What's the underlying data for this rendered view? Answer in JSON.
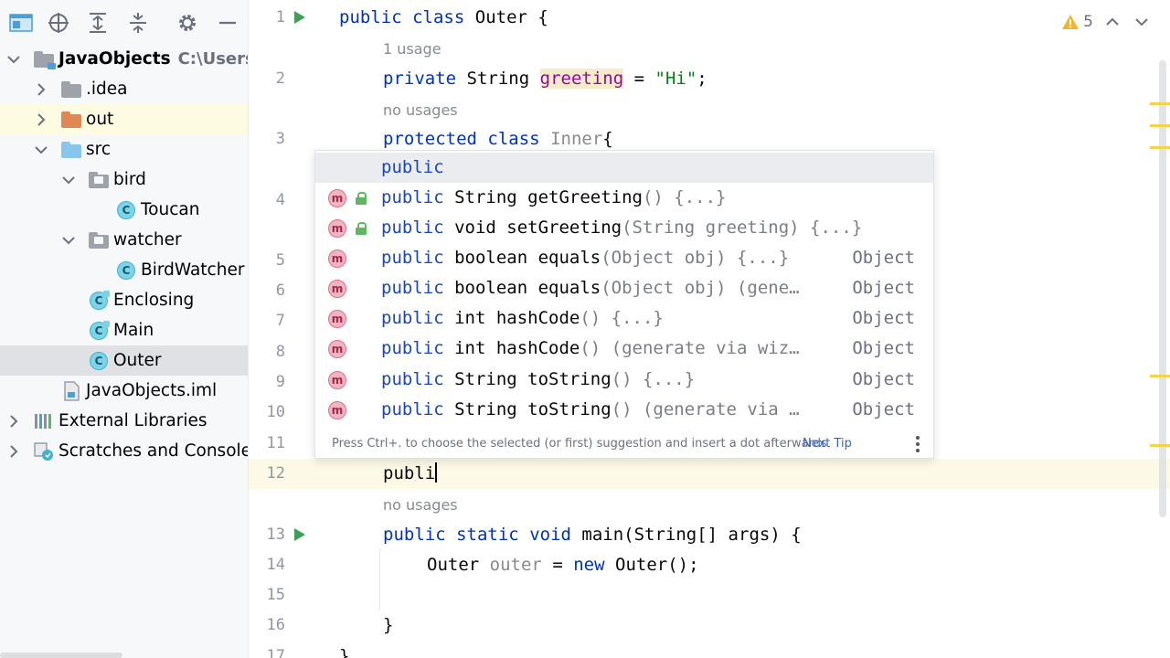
{
  "project_tree": [
    {
      "label": "JavaObjects",
      "path": "C:\\Users\\r",
      "icon": "module-folder-icon",
      "expanded": true,
      "depth": 0
    },
    {
      "label": ".idea",
      "icon": "folder-icon",
      "expanded": false,
      "depth": 1
    },
    {
      "label": "out",
      "icon": "excluded-folder-icon",
      "expanded": false,
      "depth": 1
    },
    {
      "label": "src",
      "icon": "source-folder-icon",
      "expanded": true,
      "depth": 1
    },
    {
      "label": "bird",
      "icon": "package-icon",
      "expanded": true,
      "depth": 2
    },
    {
      "label": "Toucan",
      "icon": "class-icon",
      "depth": 3
    },
    {
      "label": "watcher",
      "icon": "package-icon",
      "expanded": true,
      "depth": 2
    },
    {
      "label": "BirdWatcher",
      "icon": "class-icon",
      "depth": 3
    },
    {
      "label": "Enclosing",
      "icon": "class-icon",
      "depth": 2
    },
    {
      "label": "Main",
      "icon": "class-icon",
      "depth": 2
    },
    {
      "label": "Outer",
      "icon": "class-icon",
      "depth": 2,
      "selected": true
    },
    {
      "label": "JavaObjects.iml",
      "icon": "iml-file-icon",
      "depth": 1
    },
    {
      "label": "External Libraries",
      "icon": "libraries-icon",
      "expanded": false,
      "depth": 0
    },
    {
      "label": "Scratches and Consoles",
      "icon": "scratches-icon",
      "expanded": false,
      "depth": 0
    }
  ],
  "editor": {
    "warnings_count": "5",
    "lines": [
      {
        "num": "1",
        "code": "public class Outer {"
      },
      {
        "inlay": "1 usage"
      },
      {
        "num": "2",
        "code": "private String greeting = \"Hi\";"
      },
      {
        "inlay": "no usages"
      },
      {
        "num": "3",
        "code": "protected class Inner{"
      },
      {
        "num": "4"
      },
      {
        "num": "5"
      },
      {
        "num": "6"
      },
      {
        "num": "7"
      },
      {
        "num": "8"
      },
      {
        "num": "9"
      },
      {
        "num": "10"
      },
      {
        "num": "11"
      },
      {
        "num": "12",
        "code": "publi"
      },
      {
        "inlay": "no usages"
      },
      {
        "num": "13",
        "code": "public static void main(String[] args) {"
      },
      {
        "num": "14",
        "code": "Outer outer = new Outer();"
      },
      {
        "num": "15"
      },
      {
        "num": "16",
        "code": "}"
      },
      {
        "num": "17",
        "code": "}"
      }
    ],
    "tokens": {
      "public": "public",
      "class": "class",
      "outer_name": "Outer",
      "brace_open": "{",
      "private": "private",
      "string_type": "String",
      "greeting": "greeting",
      "eq": "=",
      "hi": "\"Hi\"",
      "semi": ";",
      "protected": "protected",
      "inner": "Inner",
      "typed": "publi",
      "static": "static",
      "void": "void",
      "main": "main",
      "main_params": "(String[] args)",
      "outer_var": "outer",
      "new": "new",
      "ctor": "Outer();",
      "brace_close": "}"
    }
  },
  "completion": {
    "items": [
      {
        "match": "public",
        "rest": "",
        "tail": "",
        "type": "",
        "icon": "",
        "selected": true
      },
      {
        "match": "public",
        "rest": " String getGreeting",
        "tail": "() {...}",
        "type": "",
        "icon": "method-icon",
        "lock": true
      },
      {
        "match": "public",
        "rest": " void setGreeting",
        "tail": "(String greeting) {...}",
        "type": "",
        "icon": "method-icon",
        "lock": true
      },
      {
        "match": "public",
        "rest": " boolean equals",
        "tail": "(Object obj) {...}",
        "type": "Object",
        "icon": "method-icon"
      },
      {
        "match": "public",
        "rest": " boolean equals",
        "tail": "(Object obj) (gene…",
        "type": "Object",
        "icon": "method-icon"
      },
      {
        "match": "public",
        "rest": " int hashCode",
        "tail": "() {...}",
        "type": "Object",
        "icon": "method-icon"
      },
      {
        "match": "public",
        "rest": " int hashCode",
        "tail": "() (generate via wiz…",
        "type": "Object",
        "icon": "method-icon"
      },
      {
        "match": "public",
        "rest": " String toString",
        "tail": "() {...}",
        "type": "Object",
        "icon": "method-icon"
      },
      {
        "match": "public",
        "rest": " String toString",
        "tail": "() (generate via …",
        "type": "Object",
        "icon": "method-icon"
      }
    ],
    "footer_text": "Press Ctrl+. to choose the selected (or first) suggestion and insert a dot afterwards",
    "footer_link": "Next Tip"
  },
  "colors": {
    "keyword": "#0033b3",
    "string": "#067d17",
    "field": "#871094",
    "run_gutter": "#3f9f5a",
    "warning": "#f2b52a"
  }
}
